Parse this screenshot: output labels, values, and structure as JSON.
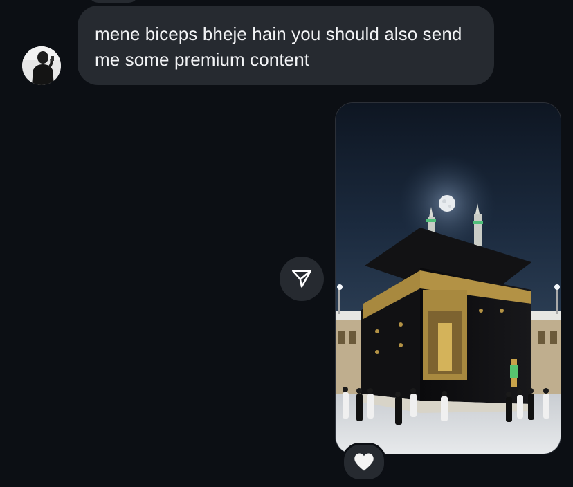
{
  "conversation": {
    "incoming_message": {
      "text": "mene biceps bheje hain you should also send me some premium content",
      "sender_avatar_icon": "user-avatar"
    },
    "outgoing_attachment": {
      "type": "photo",
      "share_icon": "paper-plane-icon"
    },
    "reaction": {
      "emoji": "🤍",
      "icon": "white-heart-icon"
    }
  },
  "colors": {
    "background": "#0c0f14",
    "bubble": "#262a30",
    "text": "#f2f3f5"
  }
}
